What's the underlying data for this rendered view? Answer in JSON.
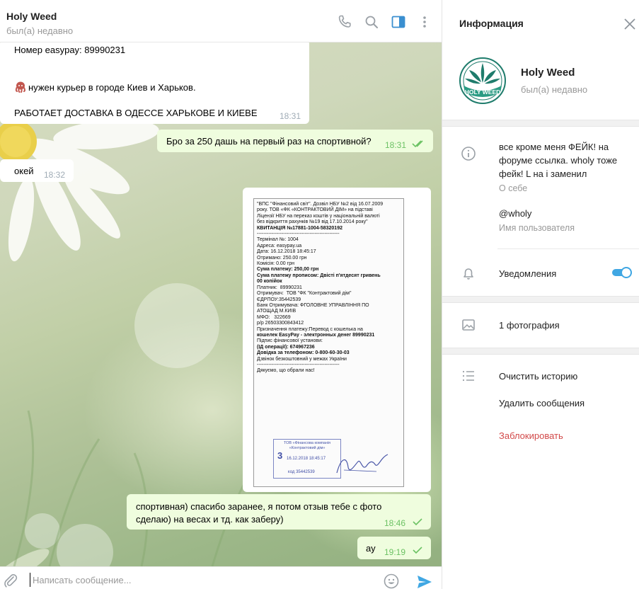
{
  "chat_header": {
    "name": "Holy Weed",
    "status": "был(а) недавно",
    "icons": [
      "phone-icon",
      "search-icon",
      "sidebar-toggle-icon",
      "more-vertical-icon"
    ]
  },
  "messages": [
    {
      "direction": "in",
      "lines": [
        "Номер easypay:   89990231",
        "",
        "",
        "нужен курьер в городе Киев и Харьков.",
        "",
        "РАБОТАЕТ ДОСТАВКА В ОДЕССЕ ХАРЬКОВЕ И КИЕВЕ"
      ],
      "line1": "Номер easypay:   89990231",
      "line2": "нужен курьер в городе Киев и Харьков.",
      "line3": "РАБОТАЕТ ДОСТАВКА В ОДЕССЕ ХАРЬКОВЕ И КИЕВЕ",
      "emoji_icon": "octopus-icon",
      "time": "18:31"
    },
    {
      "direction": "out",
      "text": "Бро за 250 дашь на первый раз на спортивной?",
      "time": "18:31",
      "read": true
    },
    {
      "direction": "in",
      "text": "окей",
      "time": "18:32"
    },
    {
      "direction": "in",
      "type": "photo",
      "photo_icon": "receipt-photo"
    },
    {
      "direction": "out",
      "line1": "спортивная) спасибо заранее, я потом отзыв тебе с фото",
      "line2": "сделаю) на весах и тд. как заберу)",
      "time": "18:46",
      "read": false
    },
    {
      "direction": "out",
      "text": "ау",
      "time": "19:19",
      "read": false
    }
  ],
  "receipt": {
    "lines": [
      {
        "t": "\"ВПС \"Фінансовий світ\". Дозвіл НБУ №2 від 16.07.2009",
        "b": false
      },
      {
        "t": "року. ТОВ «ФК «КОНТРАКТОВИЙ ДІМ» на підставі",
        "b": false
      },
      {
        "t": "Ліцензії НБУ на переказ коштів у національній валюті",
        "b": false
      },
      {
        "t": "без відкриття рахунків №19 від 17.10.2014 року\"",
        "b": false
      },
      {
        "t": "КВИТАНЦІЯ №17881-1004-58320192",
        "b": true
      },
      {
        "t": "--------------------------------------------------",
        "b": false
      },
      {
        "t": "Термінал №: 1004",
        "b": false
      },
      {
        "t": "Адреса: easypay.ua",
        "b": false
      },
      {
        "t": "Дата: 16.12.2018 18:45:17",
        "b": false
      },
      {
        "t": "Отримано: 250.00 грн",
        "b": false
      },
      {
        "t": "Комісія: 0.00 грн",
        "b": false
      },
      {
        "t": "Сума платежу: 250,00 грн",
        "b": true
      },
      {
        "t": "Сума платежу прописом: Двісті п'ятдесят гривень",
        "b": true
      },
      {
        "t": "00 копійок",
        "b": true
      },
      {
        "t": "Платник:  89990231",
        "b": false
      },
      {
        "t": "Отримувач:  ТОВ \"ФК \"Контрактовий дім\"",
        "b": false
      },
      {
        "t": "ЄДРПОУ:35442539",
        "b": false
      },
      {
        "t": "Банк Отримувача: ФГОЛОВНЕ УПРАВЛІННЯ ПО",
        "b": false
      },
      {
        "t": "АТОЩАД М.КИІВ",
        "b": false
      },
      {
        "t": "МФО:   322669",
        "b": false
      },
      {
        "t": "р/р 26503300843412",
        "b": false
      },
      {
        "t": "Призначення платежу:Перевод с кошелька на",
        "b": false
      },
      {
        "t": "кошелек EasyPay - электронных денег 89990231",
        "b": true
      },
      {
        "t": "Підпис фінансової установи:",
        "b": false
      },
      {
        "t": "(ІД операції): 674967236",
        "b": true
      },
      {
        "t": "Довідка за телефоном: 0-800-60-30-03",
        "b": true
      },
      {
        "t": "Дзвінок безкоштовний у межах України",
        "b": false
      },
      {
        "t": "--------------------------------------------------",
        "b": false
      },
      {
        "t": "Дякуємо, що обрали нас!",
        "b": false
      }
    ],
    "stamp": {
      "line1": "ТОВ «Фінансова компанія",
      "line2": "«Контрактовий дім»",
      "number": "3",
      "datetime": "16.12.2018 18:45:17",
      "code": "код 35442539"
    }
  },
  "composer": {
    "placeholder": "Написать сообщение...",
    "value": "",
    "icons": [
      "attach-icon",
      "emoji-icon",
      "send-icon"
    ]
  },
  "info_panel": {
    "title": "Информация",
    "profile": {
      "name": "Holy Weed",
      "status": "был(а) недавно",
      "avatar_icon": "holy-weed-logo",
      "avatar_text": "HOLY WEED"
    },
    "about": {
      "text": "все кроме меня ФЕЙК! на форуме ссылка. wholy тоже фейк! L на i заменил",
      "label": "О себе"
    },
    "username": {
      "value": "@wholy",
      "label": "Имя пользователя"
    },
    "notifications": {
      "label": "Уведомления",
      "enabled": true,
      "accent": "#40a7e3"
    },
    "media": {
      "label": "1 фотография"
    },
    "actions": {
      "clear": "Очистить историю",
      "delete": "Удалить сообщения",
      "block": "Заблокировать",
      "block_color": "#d24949"
    }
  }
}
